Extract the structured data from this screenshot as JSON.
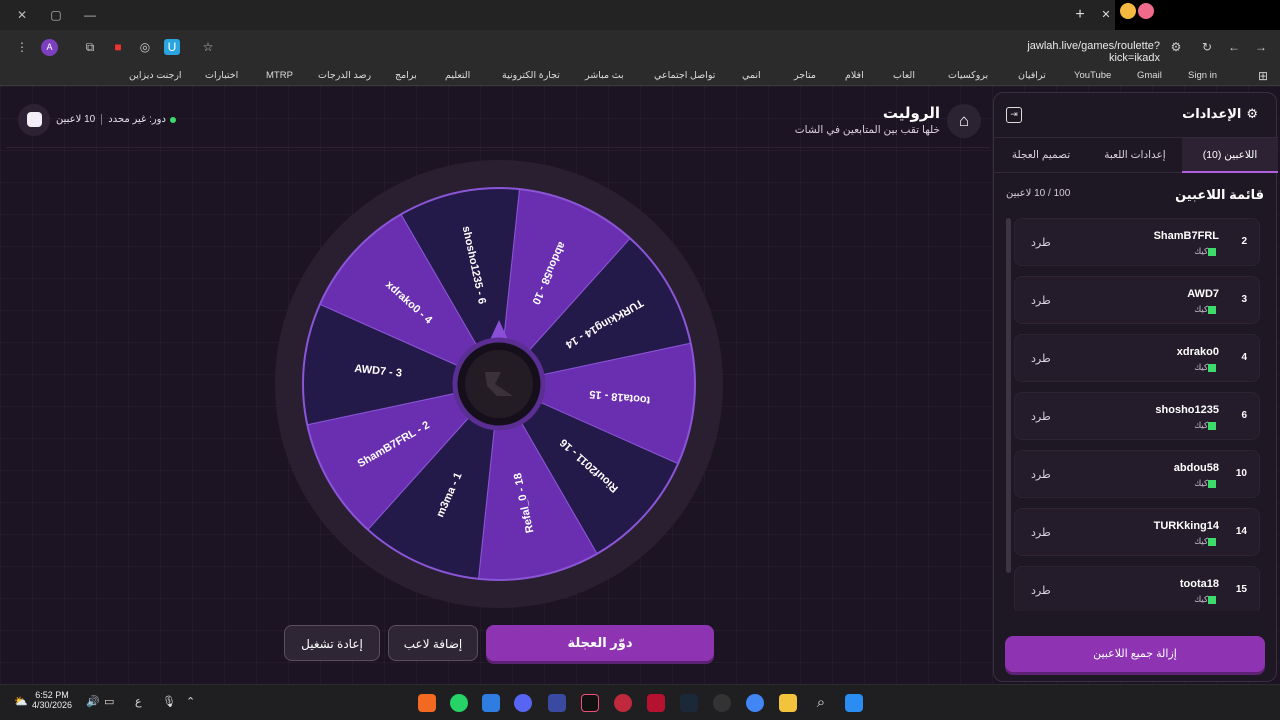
{
  "browser": {
    "url": "jawlah.live/games/roulette?kick=ikadx",
    "bookmarks": [
      "Sign in",
      "Gmail",
      "YouTube",
      "ترافيان",
      "بروكسيات",
      "العاب",
      "افلام",
      "متاجر",
      "انمي",
      "تواصل اجتماعي",
      "بث مباشر",
      "تجارة الكترونية",
      "التعليم",
      "برامج",
      "رصد الدرجات",
      "MTRP",
      "اختبارات",
      "ارجنت ديزاين"
    ],
    "profile_initial": "A"
  },
  "header": {
    "title": "الروليت",
    "subtitle": "خلها تقب بين المتابعين في الشات",
    "players_online": "10 لاعبين",
    "turn": "دور: غير محدد"
  },
  "wheel": {
    "segments": [
      {
        "label": "abdou58 - 10",
        "shade": "light"
      },
      {
        "label": "TURKking14 - 14",
        "shade": "dark"
      },
      {
        "label": "toota18 - 15",
        "shade": "light"
      },
      {
        "label": "Riouf2011 - 16",
        "shade": "dark"
      },
      {
        "label": "Refal_0 - 18",
        "shade": "light"
      },
      {
        "label": "m3ma - 1",
        "shade": "dark"
      },
      {
        "label": "ShamB7FRL - 2",
        "shade": "light"
      },
      {
        "label": "AWD7 - 3",
        "shade": "dark"
      },
      {
        "label": "xdrako0 - 4",
        "shade": "light"
      },
      {
        "label": "shosho1235 - 6",
        "shade": "dark"
      }
    ],
    "colors": {
      "light": "#6a2fb0",
      "dark": "#231a4a",
      "ring": "#2a1f31"
    }
  },
  "actions": {
    "spin": "دوّر العجلة",
    "add_player": "إضافة لاعب",
    "restart": "إعادة تشغيل"
  },
  "settings": {
    "title": "الإعدادات",
    "tabs": [
      "اللاعبين (10)",
      "إعدادات اللعبة",
      "تصميم العجلة"
    ],
    "list_title": "قائمة اللاعبين",
    "list_count": "100 / 10 لاعبين",
    "players": [
      {
        "num": "2",
        "name": "ShamB7FRL",
        "source": "كيك",
        "action": "طرد"
      },
      {
        "num": "3",
        "name": "AWD7",
        "source": "كيك",
        "action": "طرد"
      },
      {
        "num": "4",
        "name": "xdrako0",
        "source": "كيك",
        "action": "طرد"
      },
      {
        "num": "6",
        "name": "shosho1235",
        "source": "كيك",
        "action": "طرد"
      },
      {
        "num": "10",
        "name": "abdou58",
        "source": "كيك",
        "action": "طرد"
      },
      {
        "num": "14",
        "name": "TURKking14",
        "source": "كيك",
        "action": "طرد"
      },
      {
        "num": "15",
        "name": "toota18",
        "source": "كيك",
        "action": "طرد"
      }
    ],
    "clear_all": "إزالة جميع اللاعبين"
  },
  "taskbar": {
    "time": "6:52 PM",
    "date": "4/30/2026",
    "lang": "ع"
  }
}
